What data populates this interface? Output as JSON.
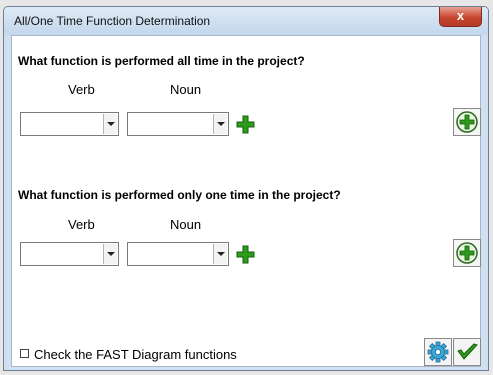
{
  "window": {
    "title": "All/One Time Function Determination",
    "close_label": "x"
  },
  "section_all": {
    "question": "What function is performed all time in the project?",
    "verb_label": "Verb",
    "noun_label": "Noun",
    "verb_value": "",
    "noun_value": ""
  },
  "section_one": {
    "question": "What function is performed only one time in the project?",
    "verb_label": "Verb",
    "noun_label": "Noun",
    "verb_value": "",
    "noun_value": ""
  },
  "footer": {
    "checkbox_label": "Check the FAST Diagram functions",
    "checkbox_checked": false
  },
  "icons": {
    "plus": "green-plus-icon",
    "circle_add": "green-circle-add-icon",
    "gear": "gear-icon",
    "check": "green-checkmark-icon"
  },
  "colors": {
    "plus_green": "#2e9b1a",
    "titlebar": "#cfe0f1",
    "close_red": "#c7462f"
  }
}
